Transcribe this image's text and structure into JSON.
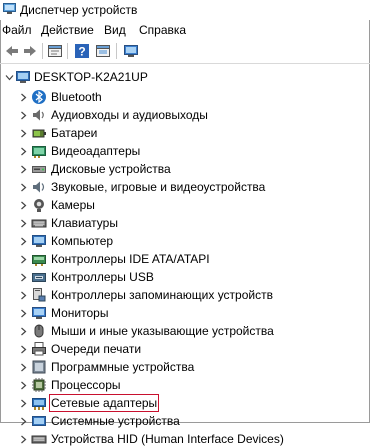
{
  "window": {
    "title": "Диспетчер устройств"
  },
  "menu": [
    "Файл",
    "Действие",
    "Вид",
    "Справка"
  ],
  "toolbar": [
    "back-icon",
    "forward-icon",
    "properties-icon",
    "help-icon",
    "view-icon",
    "monitor-icon"
  ],
  "tree": {
    "root": "DESKTOP-K2A21UP",
    "items": [
      {
        "label": "Bluetooth",
        "icon": "bluetooth-icon"
      },
      {
        "label": "Аудиовходы и аудиовыходы",
        "icon": "speaker-icon"
      },
      {
        "label": "Батареи",
        "icon": "battery-icon"
      },
      {
        "label": "Видеоадаптеры",
        "icon": "display-adapter-icon"
      },
      {
        "label": "Дисковые устройства",
        "icon": "disk-drive-icon"
      },
      {
        "label": "Звуковые, игровые и видеоустройства",
        "icon": "sound-device-icon"
      },
      {
        "label": "Камеры",
        "icon": "camera-icon"
      },
      {
        "label": "Клавиатуры",
        "icon": "keyboard-icon"
      },
      {
        "label": "Компьютер",
        "icon": "computer-icon"
      },
      {
        "label": "Контроллеры IDE ATA/ATAPI",
        "icon": "ide-controller-icon"
      },
      {
        "label": "Контроллеры USB",
        "icon": "usb-controller-icon"
      },
      {
        "label": "Контроллеры запоминающих устройств",
        "icon": "storage-controller-icon"
      },
      {
        "label": "Мониторы",
        "icon": "monitor-icon"
      },
      {
        "label": "Мыши и иные указывающие устройства",
        "icon": "mouse-icon"
      },
      {
        "label": "Очереди печати",
        "icon": "printer-icon"
      },
      {
        "label": "Программные устройства",
        "icon": "software-device-icon"
      },
      {
        "label": "Процессоры",
        "icon": "processor-icon"
      },
      {
        "label": "Сетевые адаптеры",
        "icon": "network-adapter-icon",
        "highlighted": true
      },
      {
        "label": "Системные устройства",
        "icon": "system-device-icon"
      },
      {
        "label": "Устройства HID (Human Interface Devices)",
        "icon": "hid-icon"
      }
    ]
  },
  "colors": {
    "highlight_border": "#c8102e",
    "icon_blue": "#1f6fc4"
  }
}
